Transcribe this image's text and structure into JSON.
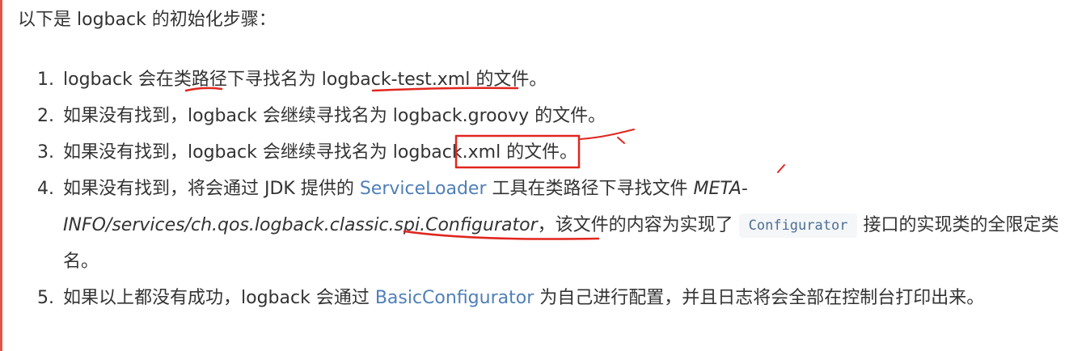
{
  "intro": "以下是 logback 的初始化步骤：",
  "steps": [
    {
      "num": "1.",
      "a": "logback 会在类路径下寻找名为 logback-test.xml 的文件。"
    },
    {
      "num": "2.",
      "a": "如果没有找到，logback 会继续寻找名为 logback.groovy 的文件。"
    },
    {
      "num": "3.",
      "a": "如果没有找到，logback 会继续寻找名为 logback.xml 的文件。"
    },
    {
      "num": "4.",
      "a": "如果没有找到，将会通过 JDK 提供的 ",
      "link": "ServiceLoader",
      "b": " 工具在类路径下寻找文件 ",
      "italic": "META-INFO/services/ch.qos.logback.classic.spi.Configurator",
      "c": "，该文件的内容为实现了 ",
      "code": "Configurator",
      "d": " 接口的实现类的全限定类名。"
    },
    {
      "num": "5.",
      "a": "如果以上都没有成功，logback 会通过 ",
      "link": "BasicConfigurator",
      "b": " 为自己进行配置，并且日志将会全部在控制台打印出来。"
    }
  ],
  "colors": {
    "text": "#333333",
    "link": "#4f7fb8",
    "annotation": "#e0261f",
    "code_bg": "#f4f6f8",
    "code_text": "#4d6f94"
  }
}
